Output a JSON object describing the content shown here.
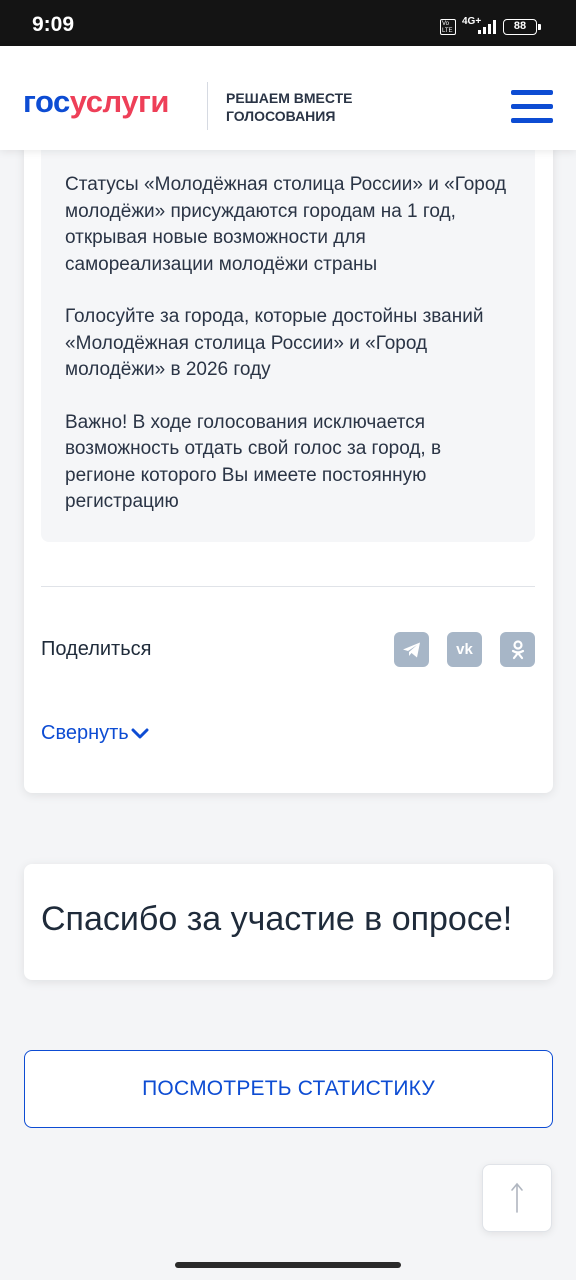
{
  "status_bar": {
    "time": "9:09",
    "volte": "Vo LTE",
    "network": "4G+",
    "battery": "88"
  },
  "header": {
    "logo_part1": "гос",
    "logo_part2": "услуги",
    "tagline_line1": "РЕШАЕМ ВМЕСТЕ",
    "tagline_line2": "ГОЛОСОВАНИЯ",
    "menu_icon": "hamburger-menu-icon"
  },
  "info": {
    "paragraphs": [
      "Статусы «Молодёжная столица России» и «Город молодёжи» присуждаются городам на 1 год, открывая новые возможности для самореализации молодёжи страны",
      "Голосуйте за города, которые достойны званий «Молодёжная столица России» и «Город молодёжи» в 2026 году",
      "Важно! В ходе голосования исключается возможность отдать свой голос за город, в регионе которого Вы имеете постоянную регистрацию"
    ]
  },
  "share": {
    "label": "Поделиться",
    "buttons": [
      {
        "name": "telegram",
        "icon": "telegram-icon"
      },
      {
        "name": "vk",
        "icon": "vk-icon",
        "text": "vk"
      },
      {
        "name": "ok",
        "icon": "odnoklassniki-icon"
      }
    ]
  },
  "collapse_label": "Свернуть",
  "thanks_text": "Спасибо за участие в опросе!",
  "stats_button": "ПОСМОТРЕТЬ СТАТИСТИКУ",
  "colors": {
    "brand_blue": "#0d4cd3",
    "brand_red": "#ee3f58",
    "share_icon_bg": "#a7b6c7"
  }
}
